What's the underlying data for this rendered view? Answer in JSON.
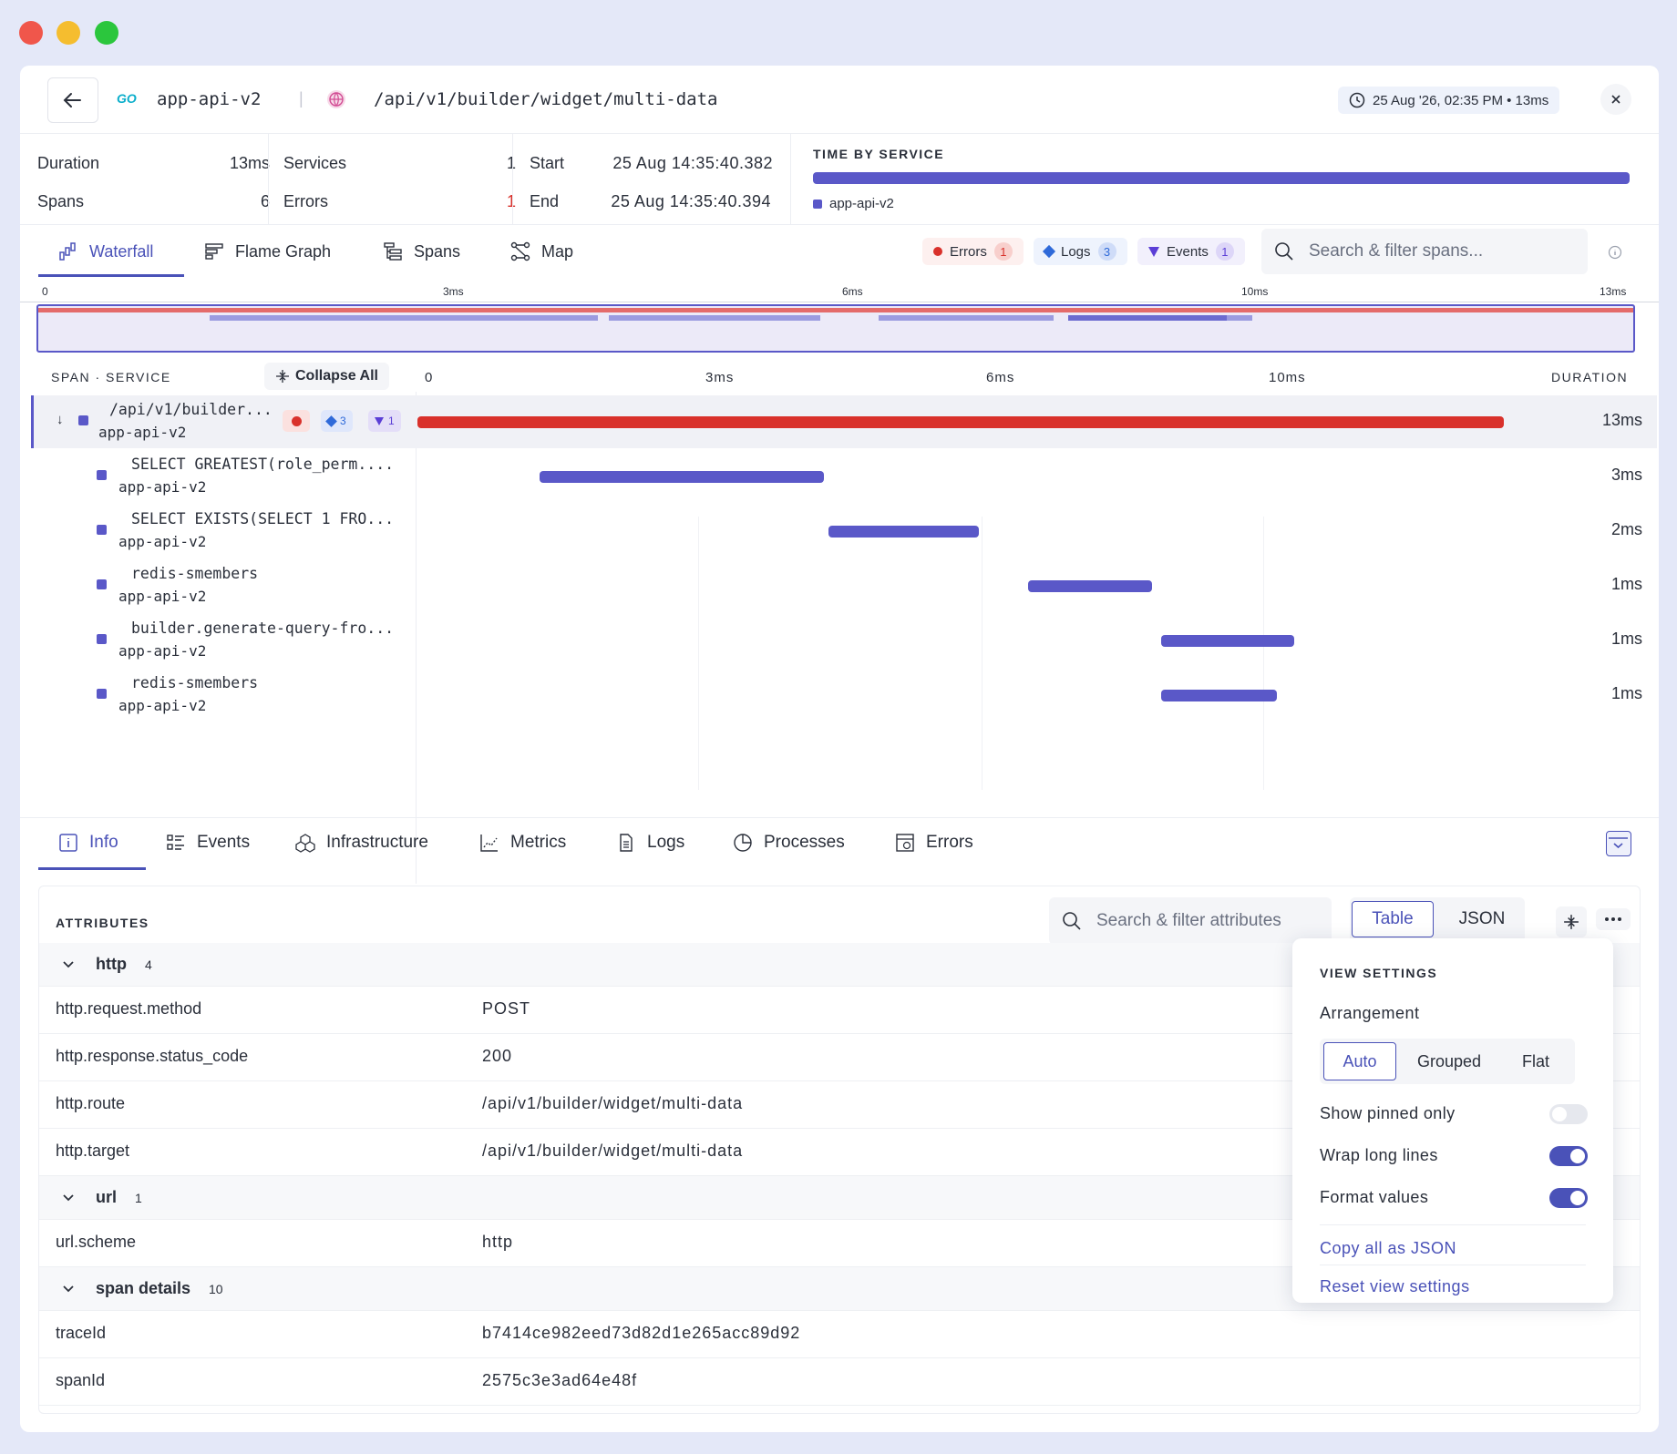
{
  "header": {
    "service_logo": "GO",
    "service_name": "app-api-v2",
    "separator": "|",
    "endpoint": "/api/v1/builder/widget/multi-data",
    "timestamp": "25 Aug '26, 02:35 PM • 13ms"
  },
  "stats": {
    "duration_label": "Duration",
    "duration_value": "13ms",
    "spans_label": "Spans",
    "spans_value": "6",
    "services_label": "Services",
    "services_value": "1",
    "errors_label": "Errors",
    "errors_value": "1",
    "start_label": "Start",
    "start_value": "25 Aug 14:35:40.382",
    "end_label": "End",
    "end_value": "25 Aug 14:35:40.394"
  },
  "time_by_service": {
    "title": "TIME BY SERVICE",
    "legend": "app-api-v2",
    "color": "#5a58c8"
  },
  "view_tabs": [
    "Waterfall",
    "Flame Graph",
    "Spans",
    "Map"
  ],
  "filters": {
    "errors_label": "Errors",
    "errors_count": "1",
    "logs_label": "Logs",
    "logs_count": "3",
    "events_label": "Events",
    "events_count": "1"
  },
  "span_search_placeholder": "Search & filter spans...",
  "minimap_ticks": [
    "0",
    "3ms",
    "6ms",
    "10ms",
    "13ms"
  ],
  "waterfall": {
    "col_span": "SPAN · SERVICE",
    "collapse_label": "Collapse All",
    "axis_ticks": [
      "0",
      "3ms",
      "6ms",
      "10ms"
    ],
    "col_duration": "DURATION",
    "total_ms": 13,
    "spans": [
      {
        "name": "/api/v1/builder...",
        "service": "app-api-v2",
        "start_ms": 0,
        "duration_ms": 13,
        "duration_label": "13ms",
        "error": true,
        "logs": "3",
        "events": "1"
      },
      {
        "name": "SELECT GREATEST(role_perm....",
        "service": "app-api-v2",
        "start_ms": 1.4,
        "duration_ms": 3.2,
        "duration_label": "3ms",
        "error": false
      },
      {
        "name": "SELECT EXISTS(SELECT 1 FRO...",
        "service": "app-api-v2",
        "start_ms": 4.65,
        "duration_ms": 1.7,
        "duration_label": "2ms",
        "error": false
      },
      {
        "name": "redis-smembers",
        "service": "app-api-v2",
        "start_ms": 6.9,
        "duration_ms": 1.4,
        "duration_label": "1ms",
        "error": false
      },
      {
        "name": "builder.generate-query-fro...",
        "service": "app-api-v2",
        "start_ms": 8.4,
        "duration_ms": 1.5,
        "duration_label": "1ms",
        "error": false
      },
      {
        "name": "redis-smembers",
        "service": "app-api-v2",
        "start_ms": 8.4,
        "duration_ms": 1.3,
        "duration_label": "1ms",
        "error": false
      }
    ]
  },
  "detail_tabs": [
    "Info",
    "Events",
    "Infrastructure",
    "Metrics",
    "Logs",
    "Processes",
    "Errors"
  ],
  "attributes": {
    "title": "ATTRIBUTES",
    "search_placeholder": "Search & filter attributes",
    "format_table": "Table",
    "format_json": "JSON",
    "groups": [
      {
        "name": "http",
        "count": "4",
        "rows": [
          {
            "key": "http.request.method",
            "value": "POST"
          },
          {
            "key": "http.response.status_code",
            "value": "200"
          },
          {
            "key": "http.route",
            "value": "/api/v1/builder/widget/multi-data"
          },
          {
            "key": "http.target",
            "value": "/api/v1/builder/widget/multi-data"
          }
        ]
      },
      {
        "name": "url",
        "count": "1",
        "rows": [
          {
            "key": "url.scheme",
            "value": "http"
          }
        ]
      },
      {
        "name": "span details",
        "count": "10",
        "rows": [
          {
            "key": "traceId",
            "value": "b7414ce982eed73d82d1e265acc89d92"
          },
          {
            "key": "spanId",
            "value": "2575c3e3ad64e48f"
          }
        ]
      }
    ]
  },
  "view_settings": {
    "title": "VIEW SETTINGS",
    "arrangement_label": "Arrangement",
    "arrangement_options": [
      "Auto",
      "Grouped",
      "Flat"
    ],
    "arrangement_selected": "Auto",
    "show_pinned_label": "Show pinned only",
    "show_pinned": false,
    "wrap_lines_label": "Wrap long lines",
    "wrap_lines": true,
    "format_values_label": "Format values",
    "format_values": true,
    "copy_json": "Copy all as JSON",
    "reset": "Reset view settings"
  },
  "colors": {
    "accent": "#5a58c8",
    "error": "#d9312b",
    "link": "#4a52b8"
  }
}
